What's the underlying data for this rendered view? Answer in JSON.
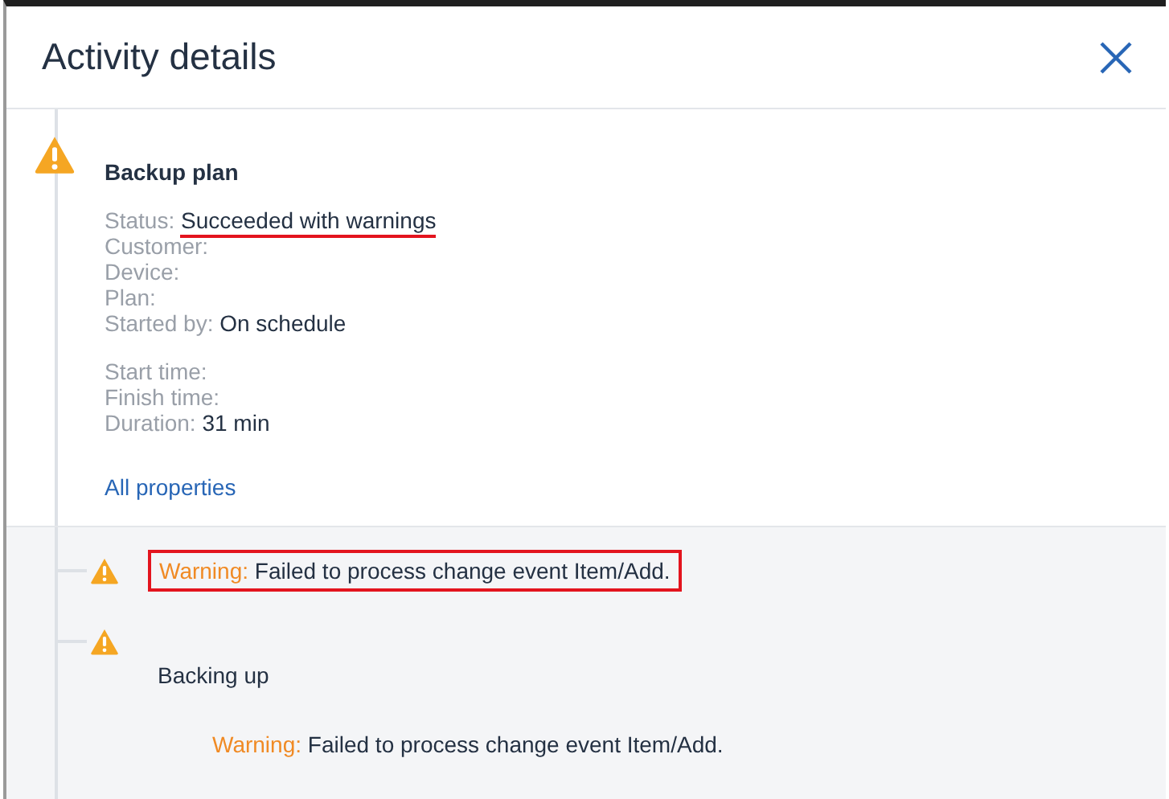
{
  "dialog": {
    "title": "Activity details"
  },
  "activity": {
    "title": "Backup plan",
    "property_groups": [
      [
        {
          "label": "Status:",
          "value": "Succeeded with warnings",
          "highlighted": true
        },
        {
          "label": "Customer:"
        },
        {
          "label": "Device:"
        },
        {
          "label": "Plan:"
        },
        {
          "label": "Started by:",
          "value": "On schedule",
          "highlighted": false
        }
      ],
      [
        {
          "label": "Start time:"
        },
        {
          "label": "Finish time:"
        },
        {
          "label": "Duration:",
          "value": "31 min",
          "highlighted": false
        }
      ]
    ],
    "link": "All properties"
  },
  "events": [
    {
      "kind": "message",
      "label": "Warning:",
      "text": "Failed to process change event Item/Add.",
      "highlighted": true
    },
    {
      "kind": "step",
      "title": "Backing up",
      "messages": [
        {
          "label": "Warning:",
          "text": "Failed to process change event Item/Add."
        }
      ]
    }
  ]
}
